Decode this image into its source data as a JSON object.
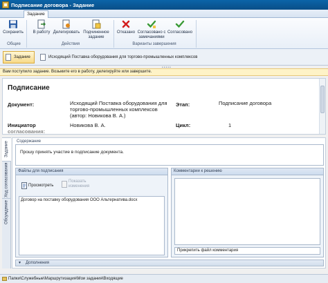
{
  "window": {
    "title": "Подписание договора - Задание"
  },
  "ribbon": {
    "active_tab": "Задание",
    "buttons": {
      "save": "Сохранить",
      "take": "В работу",
      "delegate": "Делегировать",
      "subtask_line1": "Подчиненное",
      "subtask_line2": "задание",
      "refused": "Отказано",
      "agreed_remarks_line1": "Согласовано с",
      "agreed_remarks_line2": "замечаниями",
      "agreed": "Согласовано"
    },
    "groups": {
      "common": "Общие",
      "actions": "Действия",
      "variants": "Варианты завершения"
    }
  },
  "doc_tabs": {
    "task": "Задание",
    "outgoing": "Исходящий Поставка оборудования для торгово-промышленных комплексов"
  },
  "splitter": "•••••",
  "notice": "Вам поступило задание. Возьмите его в работу, делегируйте или завершите.",
  "header": {
    "title": "Подписание",
    "document_label": "Документ:",
    "document_value_line1": "Исходящий Поставка оборудования для",
    "document_value_line2": "торгово-промышленных комплексов",
    "document_value_line3": "(автор: Новикова В. А.)",
    "stage_label": "Этап:",
    "stage_value": "Подписание договора",
    "initiator_label_line1": "Инициатор",
    "initiator_label_line2": "согласования:",
    "initiator_value": "Новикова В. А.",
    "cycle_label": "Цикл:",
    "cycle_value": "1"
  },
  "vertical_tabs": {
    "task": "Задание",
    "history": "Ход согласования",
    "discussion": "Обсуждение"
  },
  "content": {
    "label": "Содержание",
    "text": "Прошу принять участие в подписание документа."
  },
  "files": {
    "header": "Файлы для подписания",
    "view": "Просмотреть",
    "show_changes_line1": "Показать",
    "show_changes_line2": "изменения",
    "items": [
      "Договор на поставку оборудования ООО Альтернатива.docx"
    ]
  },
  "comments": {
    "header": "Комментарии к решению",
    "attach": "Прикрепить файл комментария"
  },
  "additional": "Дополнения",
  "status_bar": {
    "path": "Папки\\Служебные\\Маршрутизация\\Мои задания\\Входящие"
  },
  "colors": {
    "accent": "#0b64a8",
    "notice_bg": "#fef3c7",
    "active_doc_tab": "#f7d987"
  }
}
